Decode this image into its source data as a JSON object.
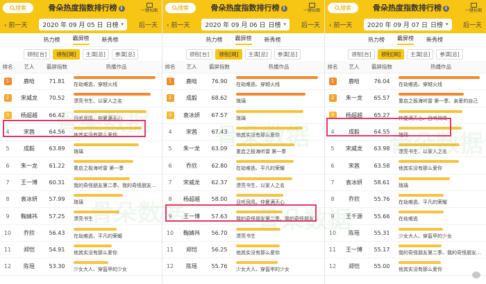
{
  "colors": {
    "header_yellow": "#f7c514",
    "bar_orange": "#f08a2c",
    "bar_yellow": "#f5c33b",
    "highlight": "#e0376a",
    "rank1": "#f08a2c",
    "rank2": "#f0a32c",
    "rank3": "#f5b82c"
  },
  "header": {
    "search_label": "搜索",
    "title": "骨朵热度指数排行榜",
    "info_label": "i",
    "share_label": "一键长图"
  },
  "nav": {
    "prev": "前一天",
    "next": "后一天"
  },
  "tabs1": [
    "热力榜",
    "霸屏榜",
    "新秀榜"
  ],
  "tabs2": [
    "领衔[台]",
    "领衔[网]",
    "主演[总]",
    "参演[总]"
  ],
  "columns": {
    "rank": "排名",
    "name": "艺人",
    "value": "霸屏指数",
    "work": "热播作品"
  },
  "panels": [
    {
      "date": "2020 年 09 月 05 日",
      "range": "日榜",
      "rows": [
        {
          "rank": "1",
          "name": "鹿晗",
          "value": "71.81",
          "work": "在劫难逃、穿越火线",
          "bar": 0.9
        },
        {
          "rank": "2",
          "name": "宋威龙",
          "value": "70.52",
          "work": "漂亮书生、以家人之名",
          "bar": 0.85
        },
        {
          "rank": "3",
          "name": "杨超越",
          "value": "66.42",
          "work": "且听凤鸣，仲夏满天心",
          "bar": 0.8
        },
        {
          "rank": "4",
          "name": "宋茜",
          "value": "64.56",
          "work": "他其实没有那么爱你",
          "bar": 0.75
        },
        {
          "rank": "5",
          "name": "成毅",
          "value": "63.89",
          "work": "琉璃",
          "bar": 0.72
        },
        {
          "rank": "6",
          "name": "朱一龙",
          "value": "61.22",
          "work": "重启之极海听雷 第一季",
          "bar": 0.66
        },
        {
          "rank": "7",
          "name": "王一博",
          "value": "60.31",
          "work": "我的奇怪朋友第二季、我的奇怪朋友...",
          "bar": 0.62
        },
        {
          "rank": "8",
          "name": "袁冰妍",
          "value": "57.99",
          "work": "琉璃",
          "bar": 0.54
        },
        {
          "rank": "9",
          "name": "鞠婧祎",
          "value": "57.25",
          "work": "漂亮书生",
          "bar": 0.5
        },
        {
          "rank": "10",
          "name": "乔欣",
          "value": "56.43",
          "work": "在劫难逃、平凡的荣耀",
          "bar": 0.47
        },
        {
          "rank": "11",
          "name": "郑恺",
          "value": "54.91",
          "work": "他其实没有那么爱你",
          "bar": 0.42
        },
        {
          "rank": "12",
          "name": "陈瑶",
          "value": "53.30",
          "work": "少女大人、穿盔甲的少女",
          "bar": 0.38
        }
      ]
    },
    {
      "date": "2020 年 09 月 06 日",
      "range": "日榜",
      "rows": [
        {
          "rank": "1",
          "name": "鹿晗",
          "value": "76.90",
          "work": "在劫难逃、穿越火线",
          "bar": 0.9
        },
        {
          "rank": "2",
          "name": "成毅",
          "value": "68.62",
          "work": "琉璃",
          "bar": 0.76
        },
        {
          "rank": "3",
          "name": "袁冰妍",
          "value": "67.57",
          "work": "琉璃",
          "bar": 0.74
        },
        {
          "rank": "4",
          "name": "宋茜",
          "value": "67.43",
          "work": "他其实没有那么爱你",
          "bar": 0.73
        },
        {
          "rank": "5",
          "name": "朱一龙",
          "value": "63.09",
          "work": "重启之极海听雷 第一季",
          "bar": 0.64
        },
        {
          "rank": "6",
          "name": "乔欣",
          "value": "62.80",
          "work": "在劫难逃、平凡的荣耀",
          "bar": 0.63
        },
        {
          "rank": "7",
          "name": "宋威龙",
          "value": "62.37",
          "work": "漂亮书生、以家人之名",
          "bar": 0.62
        },
        {
          "rank": "8",
          "name": "杨超越",
          "value": "58.00",
          "work": "且听凤鸣，仲夏满天心",
          "bar": 0.52
        },
        {
          "rank": "9",
          "name": "王一博",
          "value": "57.63",
          "work": "我的奇怪朋友第二季、我的奇怪朋友...",
          "bar": 0.51
        },
        {
          "rank": "10",
          "name": "鞠婧祎",
          "value": "56.70",
          "work": "漂亮书生",
          "bar": 0.49
        },
        {
          "rank": "11",
          "name": "郑恺",
          "value": "56.25",
          "work": "他其实没有那么爱你",
          "bar": 0.48
        },
        {
          "rank": "12",
          "name": "陈瑶",
          "value": "55.76",
          "work": "少女大人、穿盔甲的少女",
          "bar": 0.46
        }
      ]
    },
    {
      "date": "2020 年 09 月 07 日",
      "range": "日榜",
      "rows": [
        {
          "rank": "1",
          "name": "鹿晗",
          "value": "76.04",
          "work": "在劫难逃、穿越火线",
          "bar": 0.9
        },
        {
          "rank": "2",
          "name": "朱一龙",
          "value": "65.57",
          "work": "重启之极海听雷 第一季、亲爱的自己",
          "bar": 0.72
        },
        {
          "rank": "3",
          "name": "杨超越",
          "value": "65.27",
          "work": "仲夏满天心、且听凤鸣",
          "bar": 0.71
        },
        {
          "rank": "4",
          "name": "成毅",
          "value": "64.55",
          "work": "琉璃",
          "bar": 0.7
        },
        {
          "rank": "5",
          "name": "宋威龙",
          "value": "63.98",
          "work": "漂亮书生、以家人之名",
          "bar": 0.68
        },
        {
          "rank": "6",
          "name": "宋茜",
          "value": "63.58",
          "work": "他其实没有那么爱你",
          "bar": 0.67
        },
        {
          "rank": "7",
          "name": "袁冰妍",
          "value": "58.61",
          "work": "琉璃",
          "bar": 0.57
        },
        {
          "rank": "8",
          "name": "乔欣",
          "value": "55.76",
          "work": "在劫难逃、平凡的荣耀",
          "bar": 0.5
        },
        {
          "rank": "9",
          "name": "王千源",
          "value": "55.66",
          "work": "在劫难逃",
          "bar": 0.5
        },
        {
          "rank": "10",
          "name": "陈瑶",
          "value": "55.31",
          "work": "少女大人、穿盔甲的少女",
          "bar": 0.49
        },
        {
          "rank": "11",
          "name": "王一博",
          "value": "55.17",
          "work": "我的奇怪朋友第二季、我的奇怪朋友...",
          "bar": 0.48
        },
        {
          "rank": "12",
          "name": "郑恺",
          "value": "55.00",
          "work": "他其实没有那么爱你",
          "bar": 0.47
        }
      ]
    }
  ],
  "watermark": {
    "text1": "骨朵数据",
    "text2": "骨朵数据"
  }
}
